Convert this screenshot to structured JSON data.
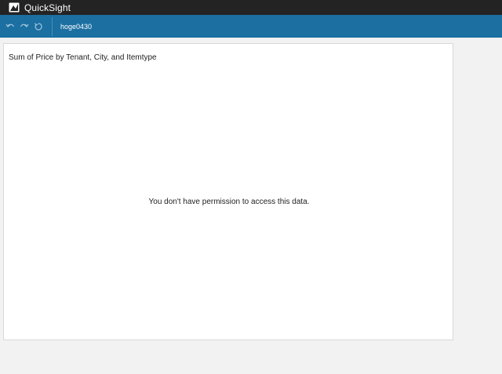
{
  "app": {
    "title": "QuickSight",
    "icon": "quicksight-logo-icon"
  },
  "toolbar": {
    "undo_icon": "undo-icon",
    "redo_icon": "redo-icon",
    "reset_icon": "reset-icon",
    "sheet_name": "hoge0430"
  },
  "visual": {
    "title": "Sum of Price by Tenant, City, and Itemtype",
    "message": "You don't have permission to access this data."
  },
  "colors": {
    "topbar": "#232323",
    "toolbar": "#1b6fa1",
    "canvas": "#f2f2f2",
    "card": "#ffffff"
  }
}
